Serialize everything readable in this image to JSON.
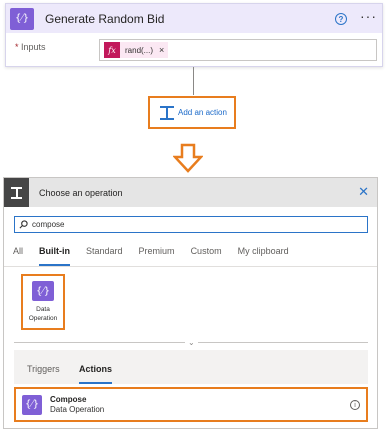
{
  "action_card": {
    "icon_glyph": "{⁄}",
    "title": "Generate Random Bid",
    "help_glyph": "?",
    "more_glyph": "···",
    "required_star": "*",
    "inputs_label": "Inputs",
    "token": {
      "icon_glyph": "fx",
      "text": "rand(...)",
      "remove_glyph": "×"
    }
  },
  "add_action": {
    "label": "Add an action"
  },
  "operation_panel": {
    "title": "Choose an operation",
    "close_glyph": "✕",
    "search": {
      "value": "compose"
    },
    "tabs": [
      {
        "label": "All"
      },
      {
        "label": "Built-in",
        "active": true
      },
      {
        "label": "Standard"
      },
      {
        "label": "Premium"
      },
      {
        "label": "Custom"
      },
      {
        "label": "My clipboard"
      }
    ],
    "connector_tile": {
      "icon_glyph": "{⁄}",
      "label_line1": "Data",
      "label_line2": "Operation"
    },
    "collapse_glyph": "⌄",
    "sub_tabs": [
      {
        "label": "Triggers"
      },
      {
        "label": "Actions",
        "active": true
      }
    ],
    "result": {
      "icon_glyph": "{⁄}",
      "name": "Compose",
      "connector": "Data Operation",
      "info_glyph": "i"
    }
  },
  "colors": {
    "highlight": "#e87d1e",
    "accent_blue": "#2b74c8",
    "data_operation": "#7f5fd6",
    "expression_token": "#c2185b"
  }
}
